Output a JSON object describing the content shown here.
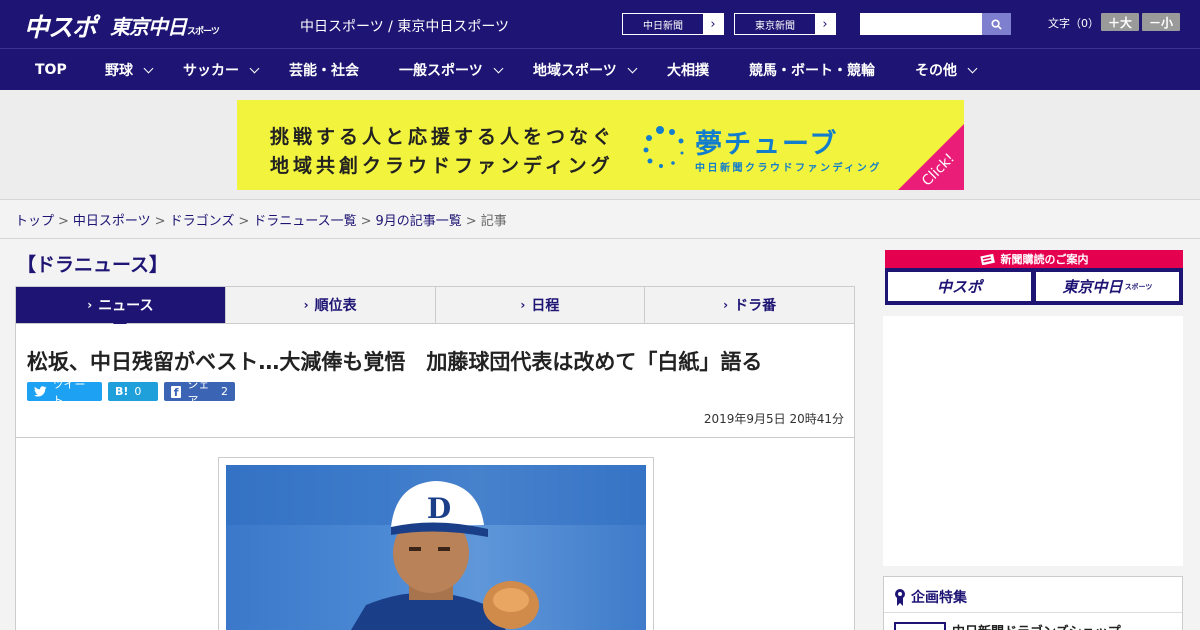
{
  "header": {
    "logo_main": "中スポ",
    "logo_tokyo": "東京中日",
    "logo_tokyo_sub": "スポーツ",
    "site_title": "中日スポーツ / 東京中日スポーツ",
    "site_buttons": [
      {
        "label": "中日新聞"
      },
      {
        "label": "東京新聞"
      }
    ],
    "search": {
      "placeholder": "",
      "icon": "search-icon"
    },
    "font_size": {
      "label": "文字（0）",
      "increase": "＋大",
      "decrease": "－小"
    }
  },
  "nav": {
    "items": [
      {
        "label": "TOP",
        "dropdown": false
      },
      {
        "label": "野球",
        "dropdown": true
      },
      {
        "label": "サッカー",
        "dropdown": true
      },
      {
        "label": "芸能・社会",
        "dropdown": false
      },
      {
        "label": "一般スポーツ",
        "dropdown": true
      },
      {
        "label": "地域スポーツ",
        "dropdown": true
      },
      {
        "label": "大相撲",
        "dropdown": false
      },
      {
        "label": "競馬・ボート・競輪",
        "dropdown": false
      },
      {
        "label": "その他",
        "dropdown": true
      }
    ]
  },
  "banner": {
    "line1": "挑戦する人と応援する人をつなぐ",
    "line2": "地域共創クラウドファンディング",
    "logo": "夢チューブ",
    "sub": "中日新聞クラウドファンディング",
    "click": "Click!"
  },
  "breadcrumb": {
    "links": [
      "トップ",
      "中日スポーツ",
      "ドラゴンズ",
      "ドラニュース一覧",
      "9月の記事一覧"
    ],
    "current": "記事",
    "separator": ">"
  },
  "main": {
    "section_title": "【ドラニュース】",
    "tabs": [
      {
        "label": "ニュース",
        "active": true
      },
      {
        "label": "順位表",
        "active": false
      },
      {
        "label": "日程",
        "active": false
      },
      {
        "label": "ドラ番",
        "active": false
      }
    ],
    "headline": "松坂、中日残留がベスト…大減俸も覚悟　加藤球団代表は改めて「白紙」語る",
    "share": {
      "tweet": {
        "icon": "twitter-bird-icon",
        "label": "ツイート"
      },
      "hatena": {
        "icon": "hatena-bookmark-icon",
        "glyph": "B!",
        "count": "0"
      },
      "facebook": {
        "icon": "facebook-icon",
        "glyph": "f",
        "label": "シェア",
        "count": "2"
      }
    },
    "date": "2019年9月5日 20時41分"
  },
  "sidebar": {
    "subscription": {
      "title": "新聞購読のご案内",
      "buttons": [
        "中スポ",
        "東京中日"
      ],
      "button_sub": "スポーツ"
    },
    "feature": {
      "title": "企画特集",
      "item": "中日新聞ドラゴンズショップ"
    }
  },
  "colors": {
    "brand_navy": "#1d1474",
    "banner_yellow": "#f2f33c",
    "banner_pink": "#ea1e79",
    "subscription_red": "#e5004f",
    "twitter": "#1da1f2",
    "hatena": "#1fa0db",
    "facebook": "#3b65b4"
  }
}
